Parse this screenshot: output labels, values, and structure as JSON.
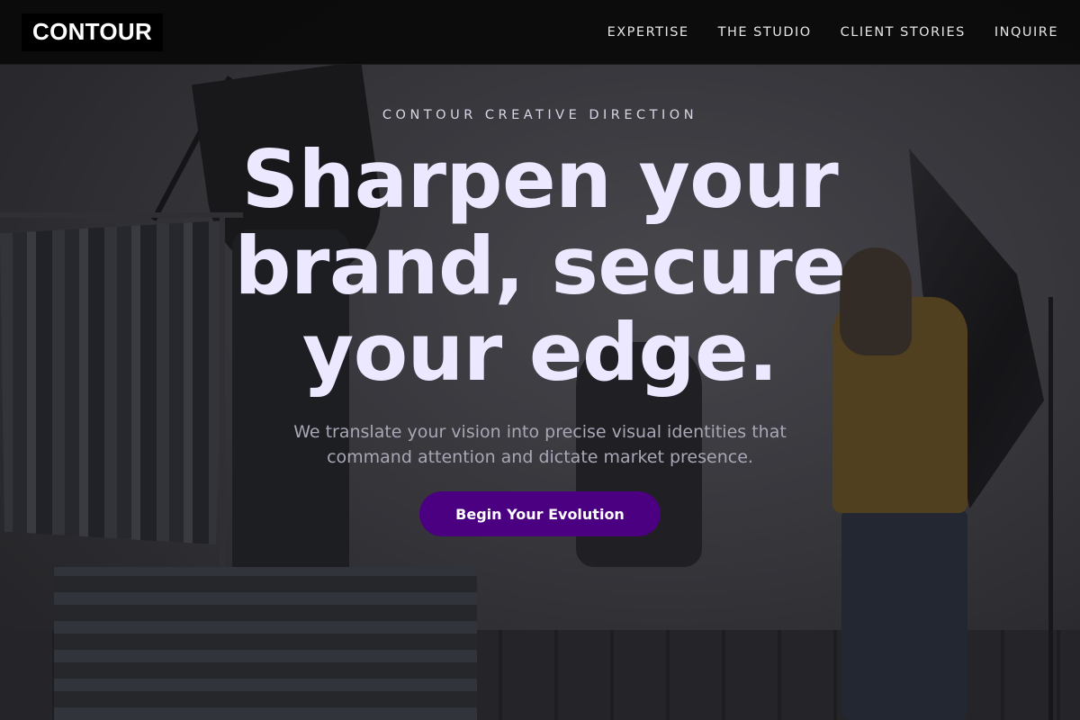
{
  "brand": {
    "logo_text": "CONTOUR"
  },
  "nav": {
    "items": [
      {
        "label": "EXPERTISE"
      },
      {
        "label": "THE STUDIO"
      },
      {
        "label": "CLIENT STORIES"
      },
      {
        "label": "INQUIRE"
      }
    ]
  },
  "hero": {
    "eyebrow": "CONTOUR CREATIVE DIRECTION",
    "headline": "Sharpen your brand, secure your edge.",
    "subtext": "We translate your vision into precise visual identities that command attention and dictate market presence.",
    "cta_label": "Begin Your Evolution"
  },
  "colors": {
    "accent": "#4b0082",
    "headline": "#ece8ff",
    "navbar_bg": "#0a0a0a"
  },
  "background": {
    "image_description_icon": "photo-studio-background"
  }
}
